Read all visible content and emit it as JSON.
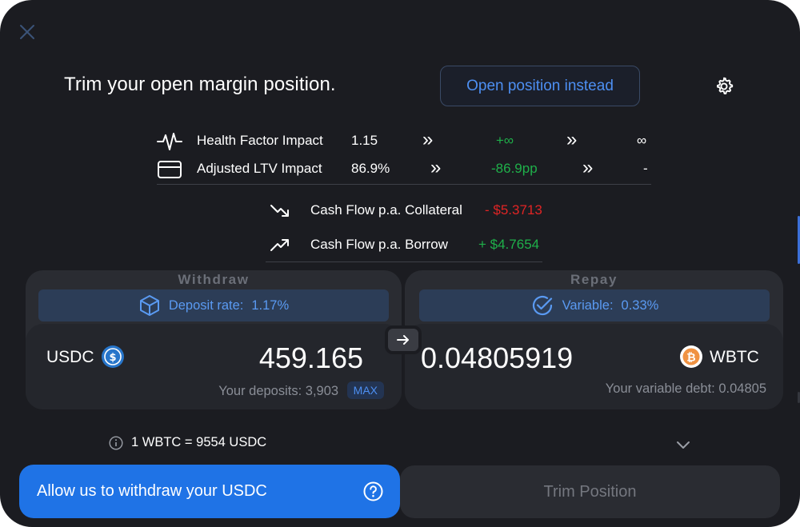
{
  "header": {
    "title": "Trim your open margin position.",
    "open_position_label": "Open position instead"
  },
  "impact": [
    {
      "label": "Health Factor Impact",
      "current": "1.15",
      "change": "+∞",
      "result": "∞"
    },
    {
      "label": "Adjusted LTV Impact",
      "current": "86.9%",
      "change": "-86.9pp",
      "result": "-"
    }
  ],
  "chevrons": "»",
  "cash_flow": [
    {
      "label": "Cash Flow p.a. Collateral",
      "value": "- $5.3713"
    },
    {
      "label": "Cash Flow p.a. Borrow",
      "value": "+ $4.7654"
    }
  ],
  "withdraw": {
    "section_label": "Withdraw",
    "rate_label": "Deposit rate:",
    "rate_value": "1.17%",
    "token": "USDC",
    "amount": "459.165",
    "balance_text": "Your deposits: 3,903",
    "max_label": "MAX"
  },
  "repay": {
    "section_label": "Repay",
    "rate_label": "Variable:",
    "rate_value": "0.33%",
    "token": "WBTC",
    "amount": "0.04805919",
    "balance_text": "Your variable debt: 0.04805"
  },
  "exchange_rate": "1 WBTC = 9554 USDC",
  "actions": {
    "allow_label": "Allow us to withdraw your USDC",
    "trim_label": "Trim Position"
  },
  "colors": {
    "accent": "#1f73e6",
    "positive": "#1fb04a",
    "negative": "#e02424",
    "background": "#1b1c21"
  }
}
